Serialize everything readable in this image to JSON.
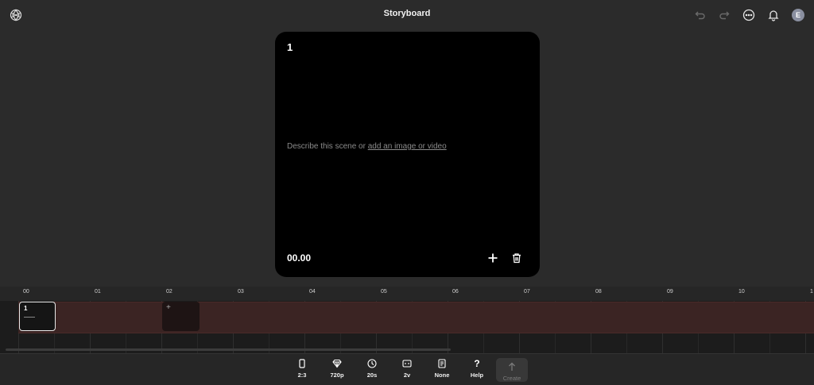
{
  "app": {
    "title": "Storyboard",
    "avatar_initial": "E"
  },
  "scene": {
    "number": "1",
    "prompt_text": "Describe this scene or ",
    "prompt_link": "add an image or video",
    "timecode": "00.00"
  },
  "timeline": {
    "ticks": [
      "00",
      "01",
      "02",
      "03",
      "04",
      "05",
      "06",
      "07",
      "08",
      "09",
      "10",
      "1"
    ],
    "clip_label": "1",
    "add_clip_symbol": "+"
  },
  "toolbar": {
    "aspect": "2:3",
    "resolution": "720p",
    "duration": "20s",
    "variations": "2v",
    "preset": "None",
    "help": "Help",
    "help_symbol": "?",
    "create": "Create"
  }
}
